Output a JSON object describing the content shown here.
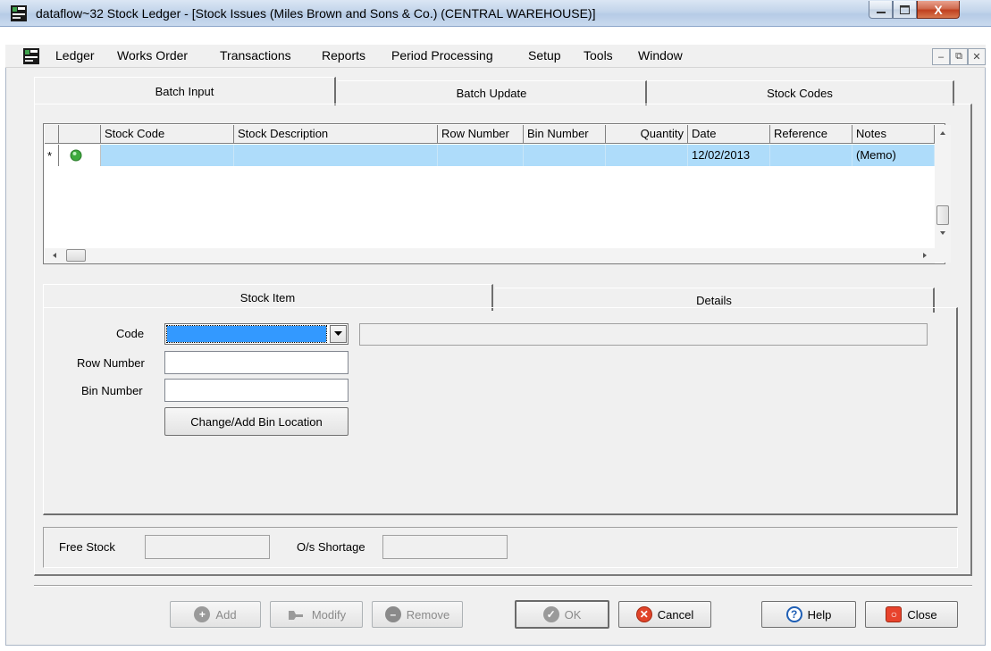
{
  "window": {
    "title": "dataflow~32 Stock Ledger - [Stock Issues (Miles Brown and Sons & Co.) (CENTRAL WAREHOUSE)]",
    "close_glyph": "X"
  },
  "menu": {
    "items": [
      "Ledger",
      "Works Order",
      "Transactions",
      "Reports",
      "Period Processing",
      "Setup",
      "Tools",
      "Window"
    ]
  },
  "tabs": {
    "items": [
      "Batch Input",
      "Batch Update",
      "Stock Codes"
    ],
    "active": "Batch Input"
  },
  "grid": {
    "columns": [
      "Stock Code",
      "Stock Description",
      "Row Number",
      "Bin Number",
      "Quantity",
      "Date",
      "Reference",
      "Notes"
    ],
    "row_marker": "*",
    "rows": [
      {
        "stock_code": "",
        "stock_description": "",
        "row_number": "",
        "bin_number": "",
        "quantity": "",
        "date": "12/02/2013",
        "reference": "",
        "notes": "(Memo)"
      }
    ]
  },
  "subtabs": {
    "items": [
      "Stock Item",
      "Details"
    ],
    "active": "Stock Item"
  },
  "stock_item": {
    "code_label": "Code",
    "row_number_label": "Row Number",
    "bin_number_label": "Bin Number",
    "code_value": "",
    "code_description": "",
    "row_number_value": "",
    "bin_number_value": "",
    "change_bin_button": "Change/Add Bin Location"
  },
  "footer_fields": {
    "free_stock_label": "Free Stock",
    "free_stock_value": "",
    "os_shortage_label": "O/s Shortage",
    "os_shortage_value": ""
  },
  "buttons": {
    "add": "Add",
    "modify": "Modify",
    "remove": "Remove",
    "ok": "OK",
    "cancel": "Cancel",
    "help": "Help",
    "close": "Close"
  }
}
